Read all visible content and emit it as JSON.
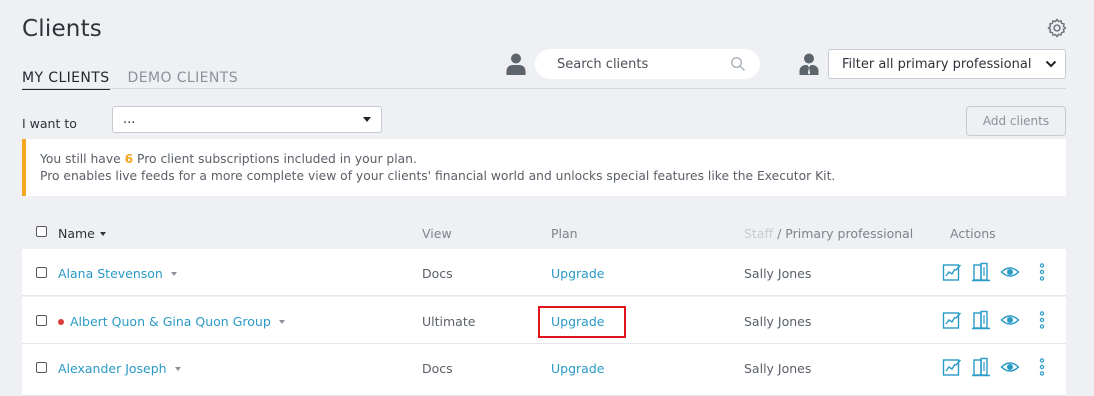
{
  "header": {
    "title": "Clients",
    "settings_icon": "gear-icon"
  },
  "tabs": [
    {
      "label": "MY CLIENTS",
      "active": true
    },
    {
      "label": "DEMO CLIENTS",
      "active": false
    }
  ],
  "search": {
    "placeholder": "Search clients"
  },
  "filter": {
    "selected": "Filter all primary professional"
  },
  "action_bar": {
    "label": "I want to",
    "selected": "...",
    "add_button": "Add clients"
  },
  "notice": {
    "line1_prefix": "You still have ",
    "count": "6",
    "line1_suffix": " Pro client subscriptions included in your plan.",
    "line2": "Pro enables live feeds for a more complete view of your clients' financial world and unlocks special features like the Executor Kit.",
    "accent_color": "#f5a623"
  },
  "table": {
    "columns": {
      "name": "Name",
      "view": "View",
      "plan": "Plan",
      "staff_muted": "Staff",
      "staff_rest": " / Primary professional",
      "actions": "Actions"
    },
    "rows": [
      {
        "name": "Alana Stevenson",
        "flag": false,
        "view": "Docs",
        "plan": "Upgrade",
        "professional": "Sally Jones"
      },
      {
        "name": "Albert Quon & Gina Quon Group",
        "flag": true,
        "view": "Ultimate",
        "plan": "Upgrade",
        "professional": "Sally Jones",
        "highlighted": true
      },
      {
        "name": "Alexander Joseph",
        "flag": false,
        "view": "Docs",
        "plan": "Upgrade",
        "professional": "Sally Jones"
      }
    ]
  },
  "colors": {
    "link": "#2a9ac6",
    "highlight": "#e0141d",
    "flag": "#d93a3a"
  }
}
